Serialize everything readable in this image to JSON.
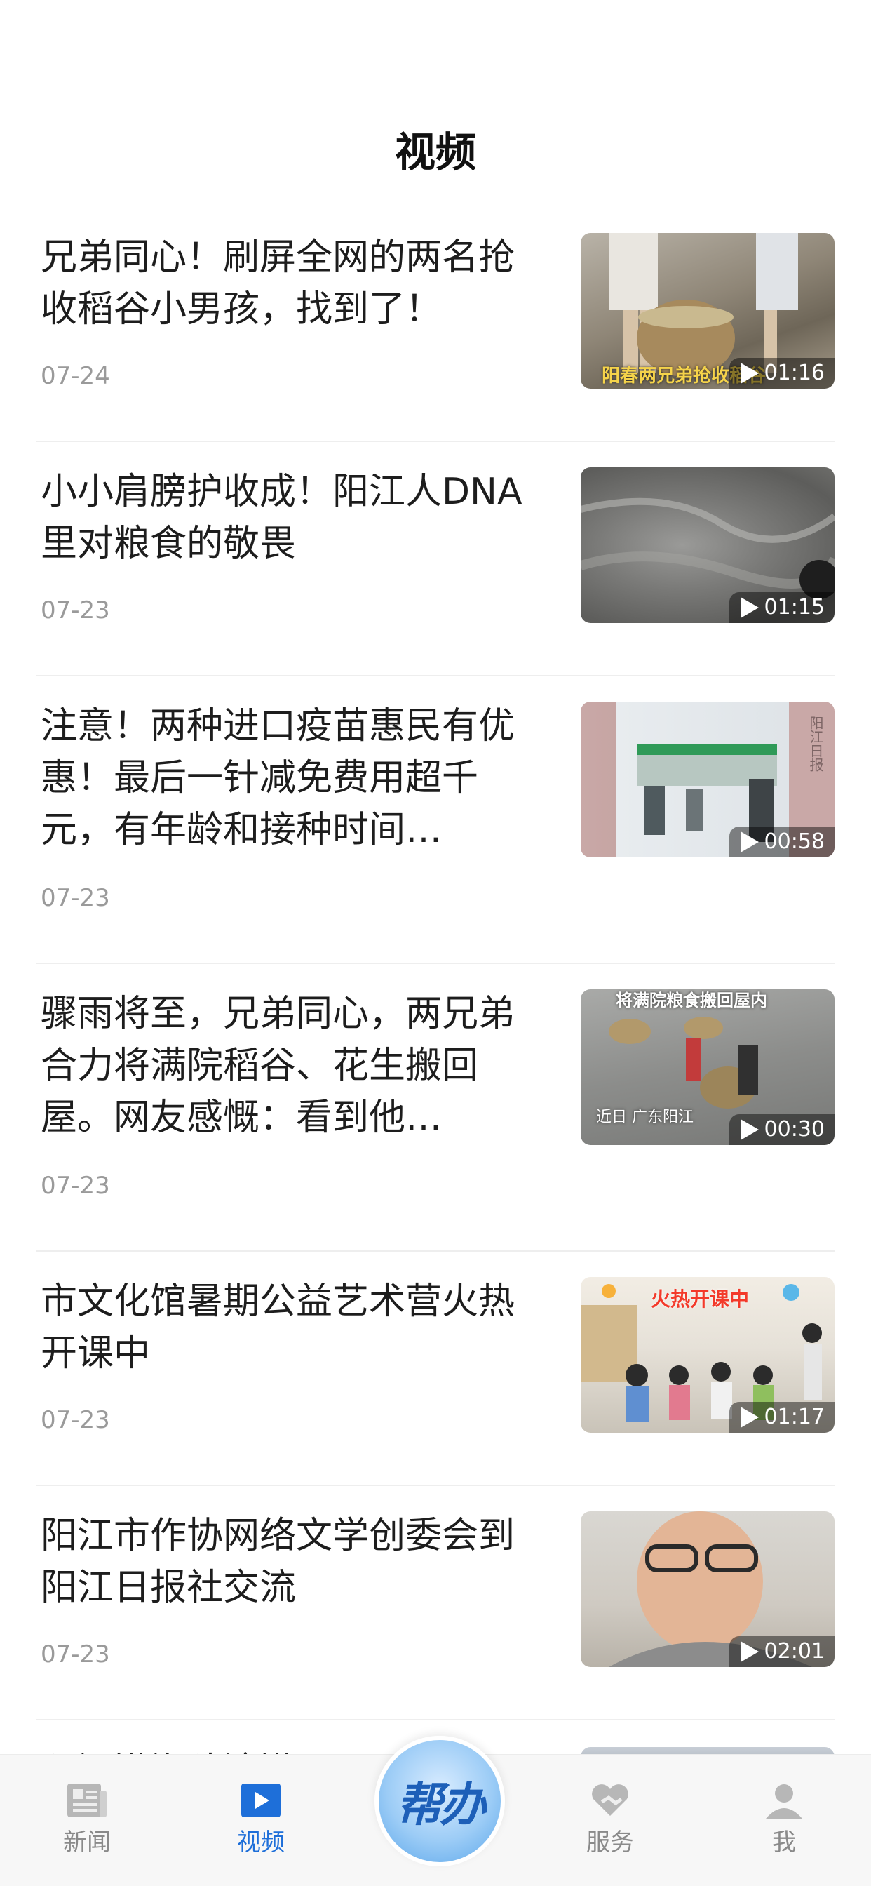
{
  "header": {
    "title": "视频"
  },
  "items": [
    {
      "title": "兄弟同心！刷屏全网的两名抢收稻谷小男孩，找到了！",
      "date": "07-24",
      "duration": "01:16",
      "thumb_caption": "阳春两兄弟抢收稻谷"
    },
    {
      "title": "小小肩膀护收成！阳江人DNA里对粮食的敬畏",
      "date": "07-23",
      "duration": "01:15",
      "thumb_caption": ""
    },
    {
      "title": "注意！两种进口疫苗惠民有优惠！最后一针减免费用超千元，有年龄和接种时间…",
      "date": "07-23",
      "duration": "00:58",
      "thumb_caption": "阳江日报"
    },
    {
      "title": "骤雨将至，兄弟同心，两兄弟合力将满院稻谷、花生搬回屋。网友感慨：看到他…",
      "date": "07-23",
      "duration": "00:30",
      "thumb_caption": "近日 广东阳江",
      "thumb_caption_top": "将满院粮食搬回屋内"
    },
    {
      "title": "市文化馆暑期公益艺术营火热开课中",
      "date": "07-23",
      "duration": "01:17",
      "thumb_caption": "火热开课中"
    },
    {
      "title": "阳江市作协网络文学创委会到阳江日报社交流",
      "date": "07-23",
      "duration": "02:01",
      "thumb_caption": ""
    }
  ],
  "peek_item": {
    "title": "阳江港海陵湾港区…"
  },
  "tabbar": {
    "tabs": [
      {
        "label": "新闻",
        "icon": "newspaper-icon"
      },
      {
        "label": "视频",
        "icon": "video-play-icon",
        "active": true
      },
      {
        "label": "帮办",
        "icon": "help-center-button"
      },
      {
        "label": "服务",
        "icon": "heart-service-icon"
      },
      {
        "label": "我",
        "icon": "person-icon"
      }
    ]
  },
  "colors": {
    "accent": "#1e6fd9",
    "inactive": "#8a8a8a",
    "date": "#9a9a9a"
  }
}
